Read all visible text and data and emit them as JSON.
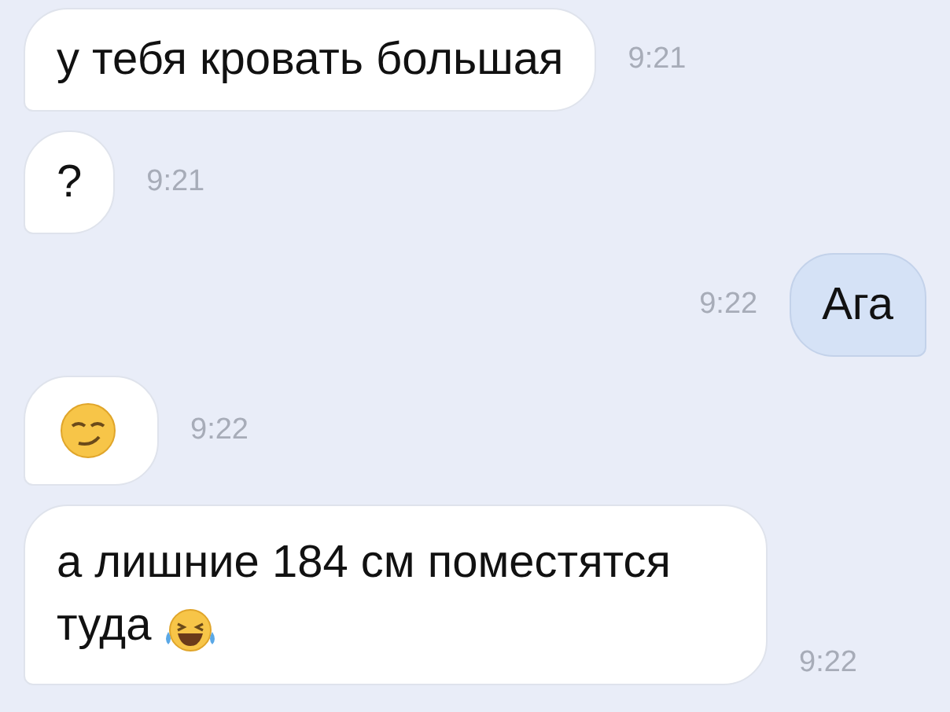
{
  "messages": [
    {
      "outgoing": false,
      "kind": "text",
      "text": "у тебя кровать большая",
      "time": "9:21"
    },
    {
      "outgoing": false,
      "kind": "text",
      "text": "?",
      "time": "9:21"
    },
    {
      "outgoing": true,
      "kind": "text",
      "text": "Ага",
      "time": "9:22"
    },
    {
      "outgoing": false,
      "kind": "emoji",
      "time": "9:22"
    },
    {
      "outgoing": false,
      "kind": "text_emoji",
      "text": "а лишние 184 см поместятся туда",
      "time": "9:22"
    }
  ]
}
